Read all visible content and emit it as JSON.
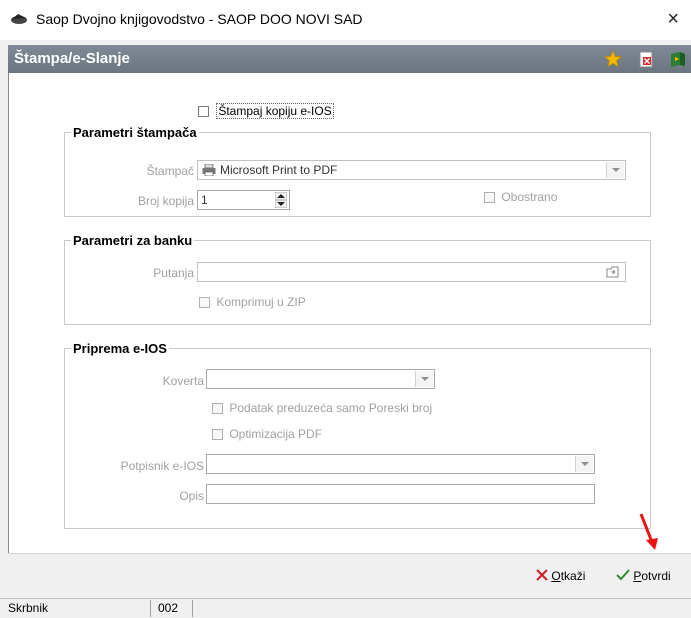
{
  "window": {
    "title": "Saop Dvojno knjigovodstvo - SAOP DOO NOVI SAD",
    "close_symbol": "×"
  },
  "header": {
    "title": "Štampa/e-Slanje"
  },
  "copy_checkbox": {
    "label": "Štampaj kopiju e-IOS",
    "checked": false
  },
  "printer_group": {
    "legend": "Parametri štampača",
    "printer_label": "Štampač",
    "printer_value": "Microsoft Print to PDF",
    "copies_label": "Broj kopija",
    "copies_value": "1",
    "duplex_label": "Obostrano"
  },
  "bank_group": {
    "legend": "Parametri za banku",
    "path_label": "Putanja",
    "path_value": "",
    "zip_label": "Komprimuj u ZIP"
  },
  "eios_group": {
    "legend": "Priprema e-IOS",
    "envelope_label": "Koverta",
    "envelope_value": "",
    "company_tax_label": "Podatak preduzeća samo Poreski broj",
    "pdf_opt_label": "Optimizacija PDF",
    "signer_label": "Potpisnik e-IOS",
    "signer_value": "",
    "desc_label": "Opis",
    "desc_value": ""
  },
  "footer": {
    "cancel_prefix": "",
    "cancel_underlined": "O",
    "cancel_rest": "tkaži",
    "confirm_underlined": "P",
    "confirm_rest": "otvrdi"
  },
  "status": {
    "user": "Skrbnik",
    "code": "002"
  },
  "colors": {
    "header_bg": "#737d88",
    "cancel_icon": "#cc2222",
    "confirm_icon": "#2e8b2e",
    "arrow": "#ee1111"
  }
}
